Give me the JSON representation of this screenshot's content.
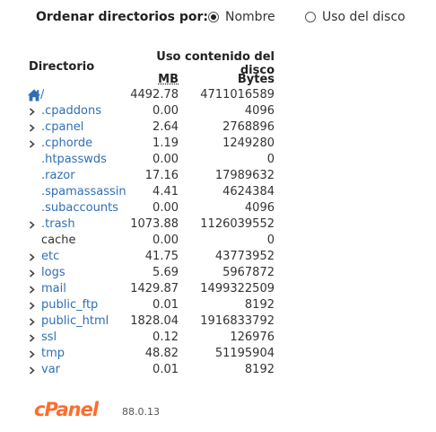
{
  "sort": {
    "label": "Ordenar directorios por:",
    "options": [
      {
        "label": "Nombre",
        "checked": true
      },
      {
        "label": "Uso del disco",
        "checked": false
      }
    ]
  },
  "table": {
    "dir_header": "Directorio",
    "usage_header": "Uso contenido del disco",
    "mb_header": "MB",
    "bytes_header": "Bytes",
    "rows": [
      {
        "name": "/",
        "mb": "4492.78",
        "bytes": "4711016589",
        "expandable": false,
        "link": true,
        "root": true
      },
      {
        "name": ".cpaddons",
        "mb": "0.00",
        "bytes": "4096",
        "expandable": true,
        "link": true
      },
      {
        "name": ".cpanel",
        "mb": "2.64",
        "bytes": "2768896",
        "expandable": true,
        "link": true
      },
      {
        "name": ".cphorde",
        "mb": "1.19",
        "bytes": "1249280",
        "expandable": true,
        "link": true
      },
      {
        "name": ".htpasswds",
        "mb": "0.00",
        "bytes": "0",
        "expandable": false,
        "link": true
      },
      {
        "name": ".razor",
        "mb": "17.16",
        "bytes": "17989632",
        "expandable": false,
        "link": true
      },
      {
        "name": ".spamassassin",
        "mb": "4.41",
        "bytes": "4624384",
        "expandable": false,
        "link": true
      },
      {
        "name": ".subaccounts",
        "mb": "0.00",
        "bytes": "4096",
        "expandable": false,
        "link": true
      },
      {
        "name": ".trash",
        "mb": "1073.88",
        "bytes": "1126039552",
        "expandable": true,
        "link": true
      },
      {
        "name": "cache",
        "mb": "0.00",
        "bytes": "0",
        "expandable": false,
        "link": false
      },
      {
        "name": "etc",
        "mb": "41.75",
        "bytes": "43773952",
        "expandable": true,
        "link": true
      },
      {
        "name": "logs",
        "mb": "5.69",
        "bytes": "5967872",
        "expandable": true,
        "link": true
      },
      {
        "name": "mail",
        "mb": "1429.87",
        "bytes": "1499322509",
        "expandable": true,
        "link": true
      },
      {
        "name": "public_ftp",
        "mb": "0.01",
        "bytes": "8192",
        "expandable": true,
        "link": true
      },
      {
        "name": "public_html",
        "mb": "1828.04",
        "bytes": "1916833792",
        "expandable": true,
        "link": true
      },
      {
        "name": "ssl",
        "mb": "0.12",
        "bytes": "126976",
        "expandable": true,
        "link": true
      },
      {
        "name": "tmp",
        "mb": "48.82",
        "bytes": "51195904",
        "expandable": true,
        "link": true
      },
      {
        "name": "var",
        "mb": "0.01",
        "bytes": "8192",
        "expandable": true,
        "link": true
      }
    ]
  },
  "footer": {
    "logo_text": "cPanel",
    "version": "88.0.13",
    "logo_color": "#ff6c2c"
  },
  "colors": {
    "link": "#2f6fb5",
    "home_icon": "#2f6fb5"
  }
}
